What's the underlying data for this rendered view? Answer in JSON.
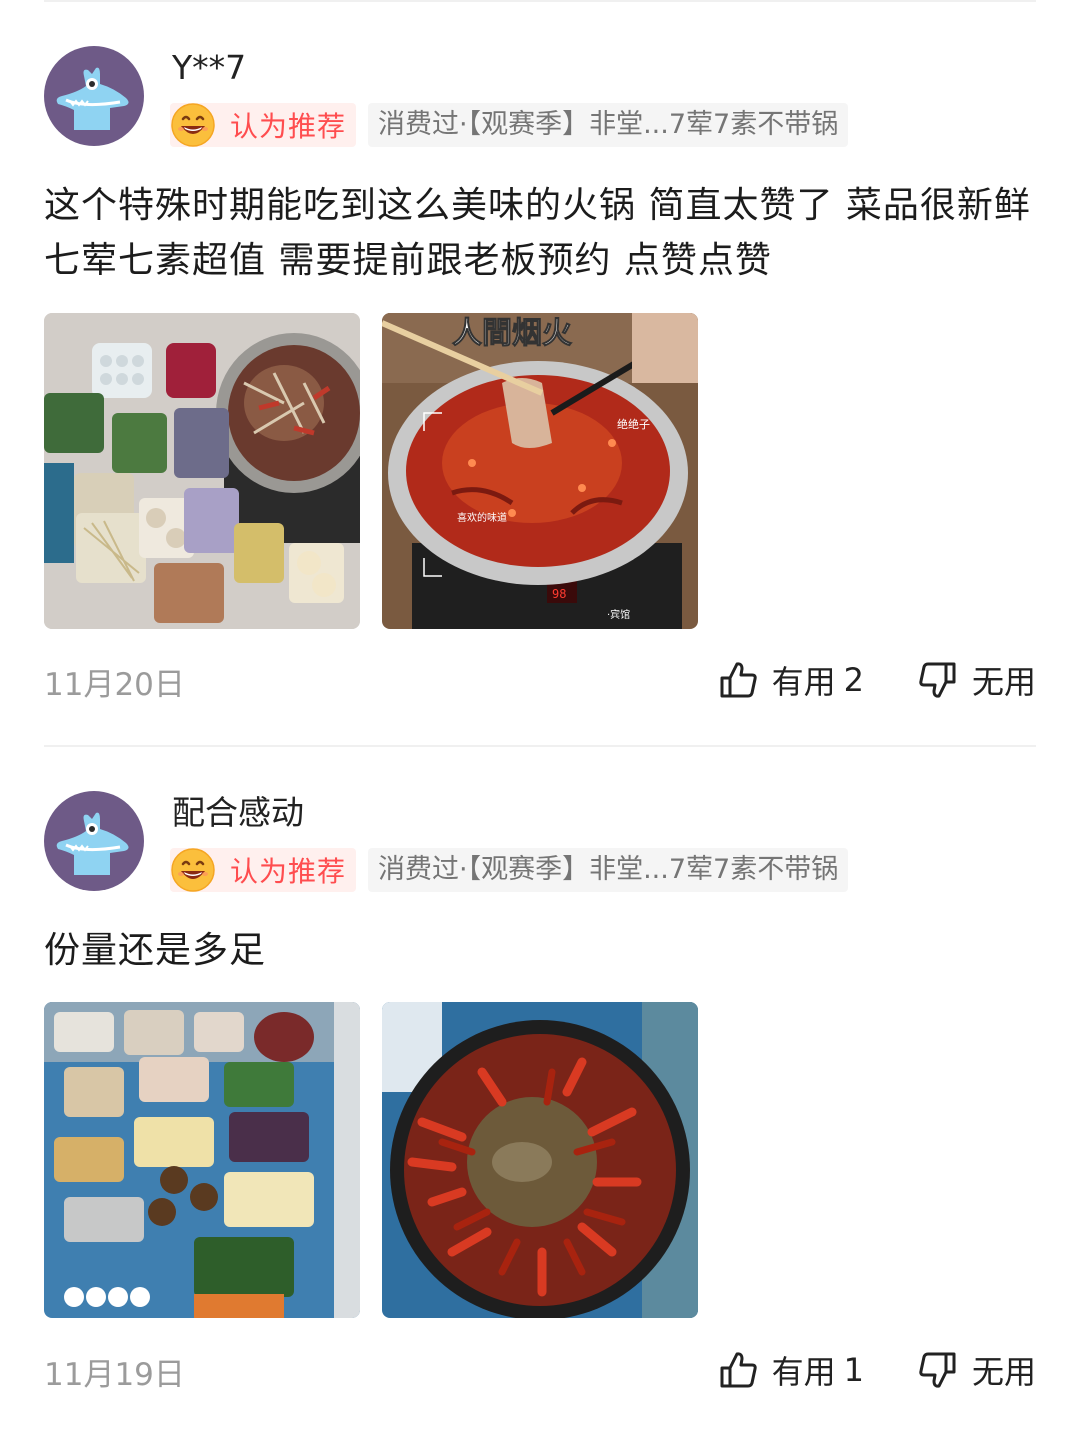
{
  "reviews": [
    {
      "username": "Y**7",
      "recommend_label": "认为推荐",
      "consumed_label": "消费过·【观赛季】非堂...7荤7素不带锅",
      "text": "这个特殊时期能吃到这么美味的火锅 简直太赞了 菜品很新鲜 七荤七素超值 需要提前跟老板预约 点赞点赞",
      "photo_overlay": {
        "title": "人間烟火",
        "note_1": "绝绝子",
        "note_2": "喜欢的味道",
        "note_3": "·宾馆",
        "stove_display": "98"
      },
      "date": "11月20日",
      "useful_label": "有用",
      "useful_count": "2",
      "useless_label": "无用"
    },
    {
      "username": "配合感动",
      "recommend_label": "认为推荐",
      "consumed_label": "消费过·【观赛季】非堂...7荤7素不带锅",
      "text": "份量还是多足",
      "date": "11月19日",
      "useful_label": "有用",
      "useful_count": "1",
      "useless_label": "无用"
    }
  ],
  "icons": {
    "avatar": "dinosaur-avatar-icon",
    "recommend": "grinning-face-icon",
    "useful": "thumbs-up-icon",
    "useless": "thumbs-down-icon"
  },
  "colors": {
    "recommend_text": "#ff4d4f",
    "recommend_bg": "#fff0ee",
    "tag_bg": "#f5f5f5",
    "avatar_bg": "#6e5a87",
    "date_text": "#9b9b9b"
  }
}
